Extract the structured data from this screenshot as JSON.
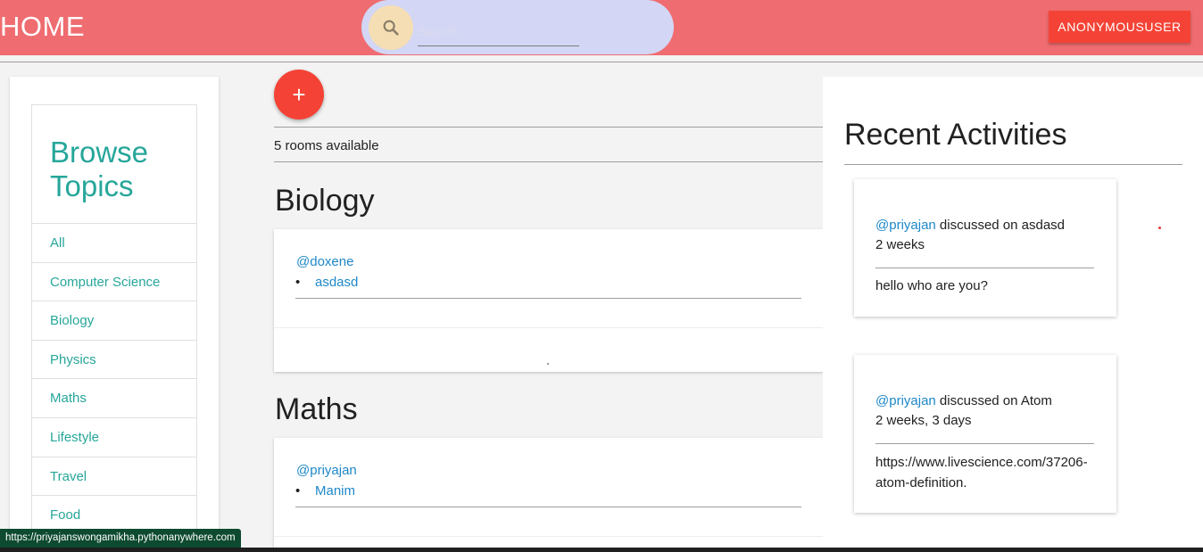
{
  "header": {
    "home_label": "HOME",
    "search_placeholder": "Search...",
    "user_button": "ANONYMOUSUSER",
    "search_icon": "search-icon"
  },
  "sidebar": {
    "title": "Browse Topics",
    "topics": [
      "All",
      "Computer Science",
      "Biology",
      "Physics",
      "Maths",
      "Lifestyle",
      "Travel",
      "Food"
    ]
  },
  "main": {
    "add_label": "+",
    "rooms_count": "5 rooms available",
    "rooms": [
      {
        "topic": "Biology",
        "host": "@doxene",
        "name": "asdasd"
      },
      {
        "topic": "Maths",
        "host": "@priyajan",
        "name": "Manim"
      }
    ]
  },
  "activities": {
    "title": "Recent Activities",
    "items": [
      {
        "user": "@priyajan",
        "action": " discussed on asdasd",
        "time": "2 weeks",
        "body": "hello who are you?"
      },
      {
        "user": "@priyajan",
        "action": " discussed on Atom",
        "time": "2 weeks, 3 days",
        "body": "https://www.livescience.com/37206-atom-definition."
      }
    ]
  },
  "status": {
    "url": "https://priyajanswongamikha.pythonanywhere.com"
  },
  "colors": {
    "topbar": "#ef6c70",
    "accent_red": "#f44336",
    "teal": "#26a69a",
    "link_blue": "#1e88c8"
  }
}
